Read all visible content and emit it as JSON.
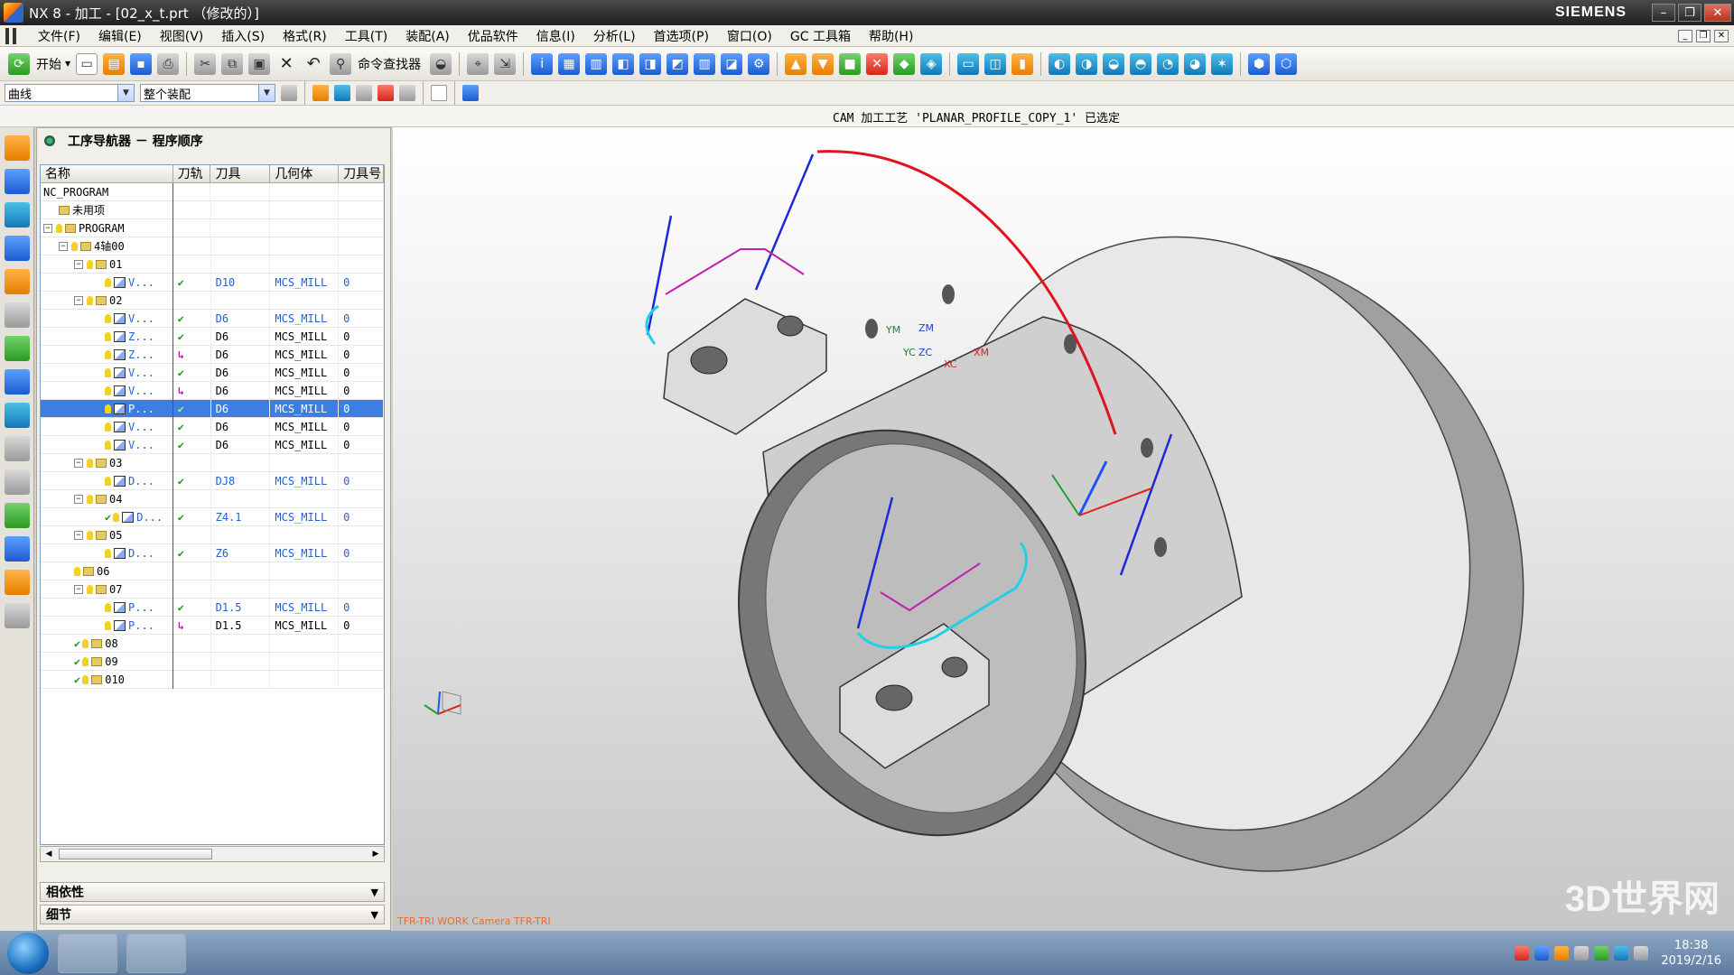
{
  "window": {
    "title": "NX 8 - 加工 - [02_x_t.prt （修改的）]",
    "brand": "SIEMENS"
  },
  "menu": [
    "文件(F)",
    "编辑(E)",
    "视图(V)",
    "插入(S)",
    "格式(R)",
    "工具(T)",
    "装配(A)",
    "优品软件",
    "信息(I)",
    "分析(L)",
    "首选项(P)",
    "窗口(O)",
    "GC 工具箱",
    "帮助(H)"
  ],
  "toolbar": {
    "start_label": "开始",
    "command_finder_label": "命令查找器"
  },
  "toolbar2": {
    "filter_value": "曲线",
    "scope_value": "整个装配"
  },
  "status_message": "CAM 加工工艺 'PLANAR_PROFILE_COPY_1' 已选定",
  "navigator": {
    "title": "工序导航器 － 程序顺序",
    "columns": [
      "名称",
      "刀轨",
      "刀具",
      "几何体",
      "刀具号"
    ],
    "rows": [
      {
        "name": "NC_PROGRAM",
        "path": "",
        "tool": "",
        "geom": "",
        "num": ""
      },
      {
        "name": "未用项",
        "path": "",
        "tool": "",
        "geom": "",
        "num": ""
      },
      {
        "name": "PROGRAM",
        "path": "",
        "tool": "",
        "geom": "",
        "num": ""
      },
      {
        "name": "4轴00",
        "path": "",
        "tool": "",
        "geom": "",
        "num": ""
      },
      {
        "name": "01",
        "path": "",
        "tool": "",
        "geom": "",
        "num": ""
      },
      {
        "name": "V...",
        "path": "✔",
        "tool": "D10",
        "geom": "MCS_MILL",
        "num": "0"
      },
      {
        "name": "02",
        "path": "",
        "tool": "",
        "geom": "",
        "num": ""
      },
      {
        "name": "V...",
        "path": "✔",
        "tool": "D6",
        "geom": "MCS_MILL",
        "num": "0"
      },
      {
        "name": "Z...",
        "path": "✔",
        "tool": "D6",
        "geom": "MCS_MILL",
        "num": "0"
      },
      {
        "name": "Z...",
        "path": "↳",
        "tool": "D6",
        "geom": "MCS_MILL",
        "num": "0"
      },
      {
        "name": "V...",
        "path": "✔",
        "tool": "D6",
        "geom": "MCS_MILL",
        "num": "0"
      },
      {
        "name": "V...",
        "path": "↳",
        "tool": "D6",
        "geom": "MCS_MILL",
        "num": "0"
      },
      {
        "name": "P...",
        "path": "✔",
        "tool": "D6",
        "geom": "MCS_MILL",
        "num": "0"
      },
      {
        "name": "V...",
        "path": "✔",
        "tool": "D6",
        "geom": "MCS_MILL",
        "num": "0"
      },
      {
        "name": "V...",
        "path": "✔",
        "tool": "D6",
        "geom": "MCS_MILL",
        "num": "0"
      },
      {
        "name": "03",
        "path": "",
        "tool": "",
        "geom": "",
        "num": ""
      },
      {
        "name": "D...",
        "path": "✔",
        "tool": "DJ8",
        "geom": "MCS_MILL",
        "num": "0"
      },
      {
        "name": "04",
        "path": "",
        "tool": "",
        "geom": "",
        "num": ""
      },
      {
        "name": "D...",
        "path": "✔",
        "tool": "Z4.1",
        "geom": "MCS_MILL",
        "num": "0"
      },
      {
        "name": "05",
        "path": "",
        "tool": "",
        "geom": "",
        "num": ""
      },
      {
        "name": "D...",
        "path": "✔",
        "tool": "Z6",
        "geom": "MCS_MILL",
        "num": "0"
      },
      {
        "name": "06",
        "path": "",
        "tool": "",
        "geom": "",
        "num": ""
      },
      {
        "name": "07",
        "path": "",
        "tool": "",
        "geom": "",
        "num": ""
      },
      {
        "name": "P...",
        "path": "✔",
        "tool": "D1.5",
        "geom": "MCS_MILL",
        "num": "0"
      },
      {
        "name": "P...",
        "path": "↳",
        "tool": "D1.5",
        "geom": "MCS_MILL",
        "num": "0"
      },
      {
        "name": "08",
        "path": "",
        "tool": "",
        "geom": "",
        "num": ""
      },
      {
        "name": "09",
        "path": "",
        "tool": "",
        "geom": "",
        "num": ""
      },
      {
        "name": "010",
        "path": "",
        "tool": "",
        "geom": "",
        "num": ""
      }
    ],
    "panels": [
      "相依性",
      "细节"
    ]
  },
  "viewport": {
    "footer": "TFR-TRI WORK Camera TFR-TRI",
    "watermark": "3D世界网",
    "axes": [
      "YM",
      "ZM",
      "YC",
      "ZC",
      "XC",
      "XM"
    ]
  },
  "taskbar": {
    "time": "18:38",
    "date": "2019/2/16"
  }
}
